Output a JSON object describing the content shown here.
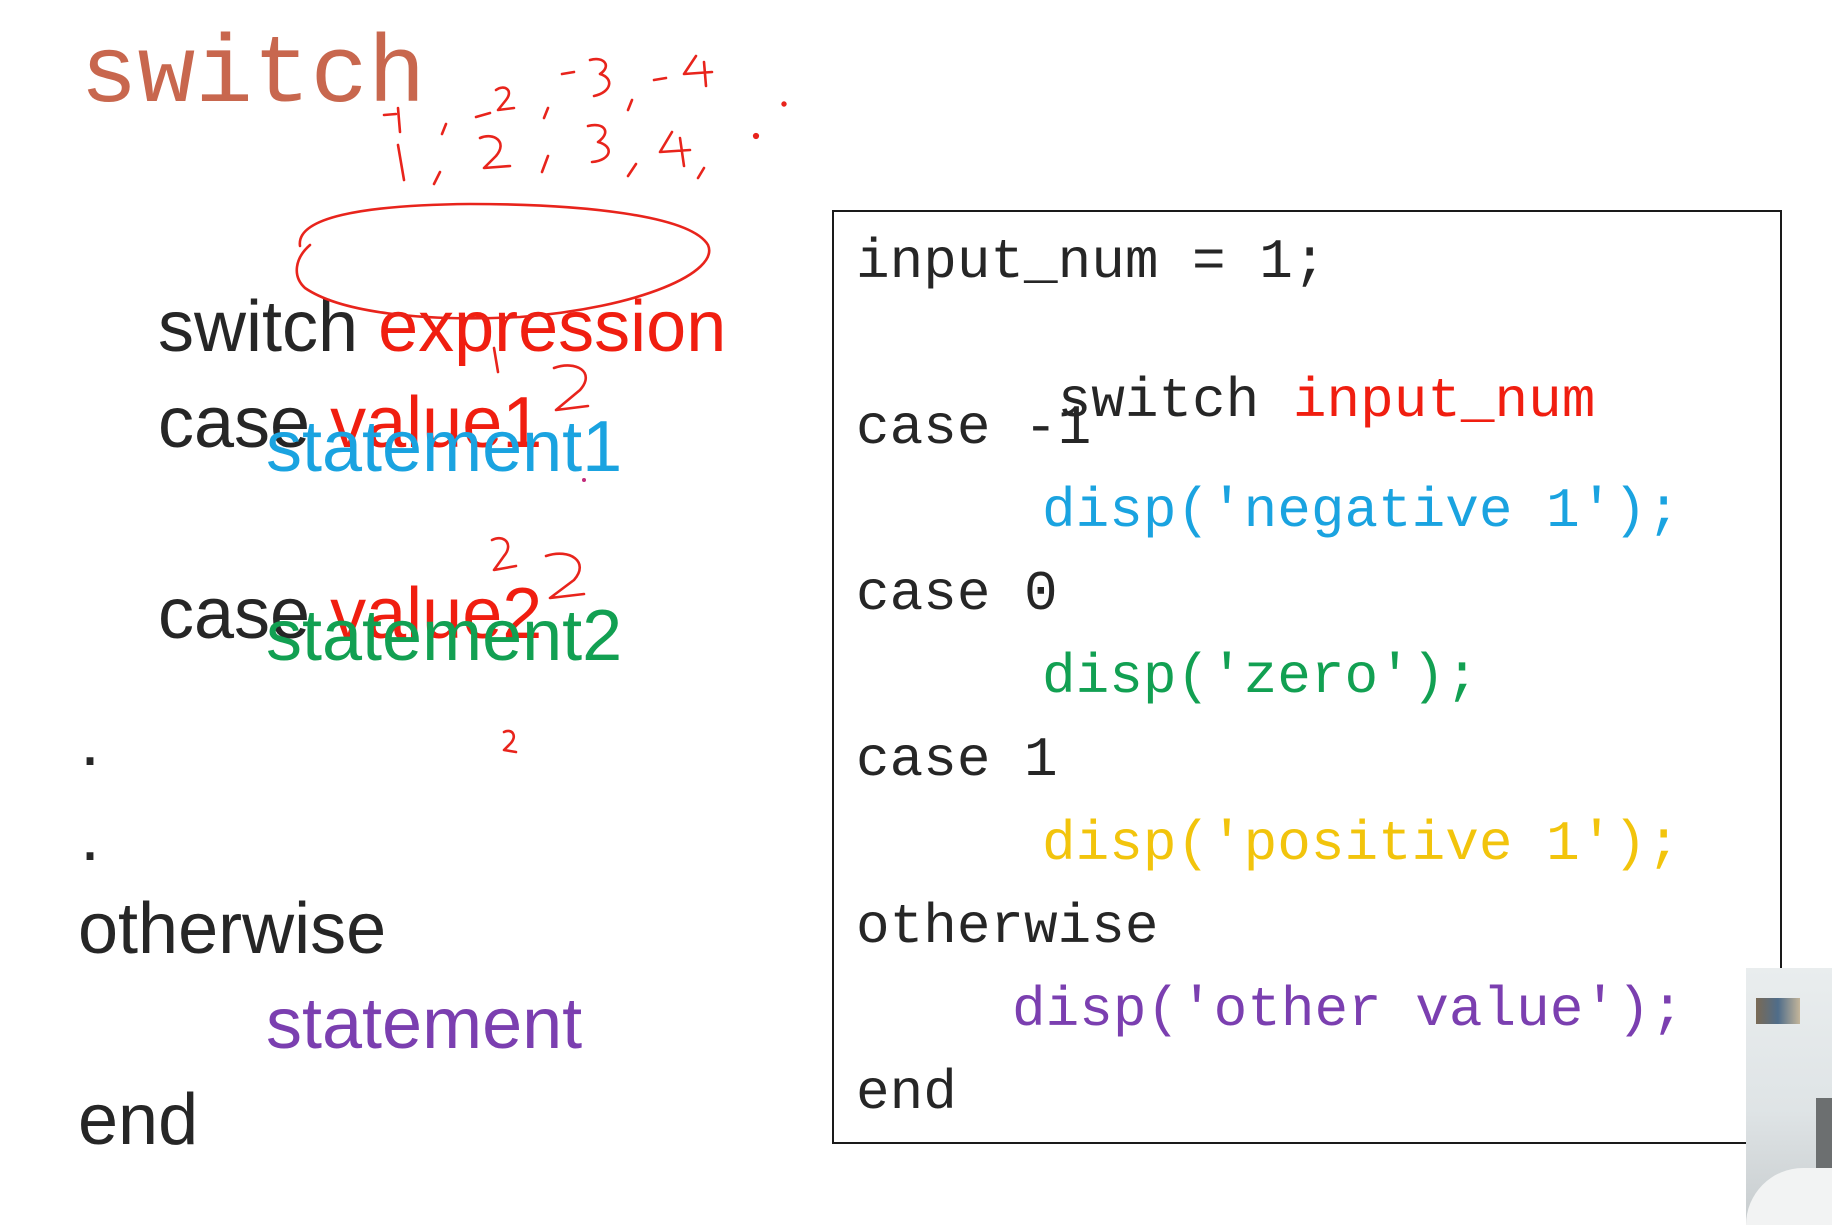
{
  "slide": {
    "title": "switch",
    "syntax": {
      "line1_keyword": "switch",
      "line1_arg": "expression",
      "line2_keyword": "case",
      "line2_arg": "value1",
      "line3_statement": "statement1",
      "line4_keyword": "case",
      "line4_arg": "value2",
      "line5_statement": "statement2",
      "dot1": ".",
      "dot2": ".",
      "line6_keyword": "otherwise",
      "line7_statement": "statement",
      "line8_keyword": "end"
    },
    "code": {
      "line1": "input_num = 1;",
      "line2_keyword": "switch ",
      "line2_var": "input_num",
      "line3": "case -1",
      "line4": "disp('negative 1');",
      "line5": "case 0",
      "line6": "disp('zero');",
      "line7": "case 1",
      "line8": "disp('positive 1');",
      "line9": "otherwise",
      "line10": "disp('other value');",
      "line11": "end"
    },
    "annotations": {
      "ink_color": "#e8241c",
      "handwritten_row1": "-1, -2, -3, -4",
      "handwritten_row2": "1, 2, 3, 4, .",
      "handwritten_value1": "1 2",
      "handwritten_value2": "2 2",
      "handwritten_misc": "2"
    }
  },
  "colors": {
    "title": "#c8674e",
    "keyword": "#262626",
    "red": "#f01e10",
    "blue": "#1aa3e0",
    "green": "#12a052",
    "yellow": "#f2c40c",
    "purple": "#7b3fb0"
  }
}
